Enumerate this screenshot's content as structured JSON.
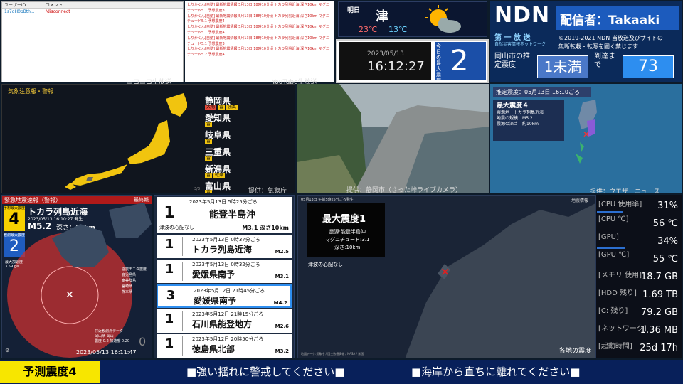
{
  "chat": {
    "col_user": "ユーザーID",
    "col_comment": "コメント",
    "user": "1s7dH0pBth...",
    "command": "/disconnect"
  },
  "youtube": {
    "lines": [
      "しりかくん[自動] 最新地震情報 5月13日 18時10分頃 トカラ列島近海 深さ10km マグニチュード5.1 予想震度3",
      "しりかくん[自動] 最新地震情報 5月13日 18時10分頃 トカラ列島近海 深さ10km マグニチュード5.1 予想震度4",
      "しりかくん[自動] 最新地震情報 5月13日 18時10分頃 トカラ列島近海 深さ10km マグニチュード5.1 予想震度4",
      "しりかくん[自動] 最新地震情報 5月13日 18時10分頃 トカラ列島近海 深さ10km マグニチュード5.1 予想震度3",
      "しりかくん[自動] 最新地震情報 5月13日 18時10分頃 トカラ列島近海 深さ10km マグニチュード5.2 予想震度4"
    ]
  },
  "weather": {
    "day": "明日",
    "city": "津",
    "high": "23℃",
    "low": "13℃"
  },
  "clock": {
    "date": "2023/05/13",
    "time": "16:12:27",
    "max_label": "今日の最大震度",
    "max_value": "2"
  },
  "ndn": {
    "logo": "NDN",
    "streamer": "配信者：Takaaki",
    "sub1": "第 一 放 送",
    "sub2": "自然災害情報ネットワーク",
    "copyright": "©2019-2021 NDN 当放送及びサイトの",
    "copyright2": "無断転載・転写を固く禁じます",
    "okayama": "岡山市の推定震度",
    "okayama_value": "1未満",
    "arrival": "到達まで",
    "arrival_value": "73"
  },
  "panel_labels": {
    "niconico": "ニコニコ生放送",
    "youtube": "YouTube生放送",
    "jma_credit": "提供：気象庁",
    "cam_credit": "提供：静岡市（さった峠ライブカメラ）",
    "weathernews_credit": "提供：ウエザーニュース"
  },
  "warnings": {
    "title": "気象注意報・警報",
    "prefs": [
      {
        "name": "静岡県",
        "tags": [
          "大雨",
          "雷",
          "強風"
        ]
      },
      {
        "name": "愛知県",
        "tags": [
          "雷"
        ]
      },
      {
        "name": "岐阜県",
        "tags": [
          "雷"
        ]
      },
      {
        "name": "三重県",
        "tags": [
          "雷"
        ]
      },
      {
        "name": "新潟県",
        "tags": [
          "雷",
          "乾燥"
        ]
      },
      {
        "name": "富山県",
        "tags": [
          "雷"
        ]
      }
    ],
    "page": "3/3"
  },
  "jma": {
    "title": "推定震度：05月13日 16:10ごろ",
    "max": "最大震度４",
    "epi_label": "震源地",
    "epi": "トカラ列島近海",
    "mag_label": "地震の規模",
    "mag": "M5.2",
    "depth_label": "震源の深さ",
    "depth": "約10km"
  },
  "eew": {
    "title": "緊急地震速報（警報）",
    "final": "最終報",
    "intensity": "4",
    "intensity_label": "予想最大震度",
    "region": "トカラ列島近海",
    "time": "2023/05/13 16:10:27 発生",
    "mag": "M5.2",
    "depth_label": "深さ：",
    "depth": "10km",
    "obs_label": "観測最大震度",
    "obs": "2",
    "legend": [
      "鹿児島県",
      "奄美群島",
      "宮崎県",
      "熊本県"
    ],
    "legend_title": "強震モニタ震度",
    "near_label": "付近観測点データ",
    "near_place": "岡山県 岡山",
    "near_vals": "震度-0.2 加速度 0.20",
    "near_value": "0",
    "timestamp": "2023/05/13 16:11:47",
    "accel_label": "最大加速度",
    "accel": "3.59 gal"
  },
  "quake_list": [
    {
      "shindo": "1",
      "date": "2023年5月13日 5時25分ごろ",
      "name": "能登半島沖",
      "sub": "津波の心配なし",
      "mag": "M3.1 深さ10km"
    },
    {
      "shindo": "1",
      "date": "2023年5月13日 0時37分ごろ",
      "name": "トカラ列島近海",
      "mag": "M2.5"
    },
    {
      "shindo": "1",
      "date": "2023年5月13日 0時32分ごろ",
      "name": "愛媛県南予",
      "mag": "M3.1"
    },
    {
      "shindo": "3",
      "date": "2023年5月12日 21時45分ごろ",
      "name": "愛媛県南予",
      "mag": "M4.2"
    },
    {
      "shindo": "1",
      "date": "2023年5月12日 21時15分ごろ",
      "name": "石川県能登地方",
      "mag": "M2.6"
    },
    {
      "shindo": "1",
      "date": "2023年5月12日 20時50分ごろ",
      "name": "徳島県北部",
      "mag": "M3.2"
    }
  ],
  "quake_map": {
    "head": "05月13日 午前5時25分ごろ発生",
    "top_right": "地震情報",
    "max": "最大震度1",
    "epi": "震源:能登半島沖",
    "mag": "マグニチュード:3.1",
    "depth": "深さ:10km",
    "tsunami": "津波の心配なし",
    "caption": "各地の震度",
    "src": "地図データ:気象庁 / 国土数値情報 / NASA / 米国"
  },
  "stats": [
    {
      "k": "[CPU 使用率]",
      "v": "31%"
    },
    {
      "k": "[CPU ℃]",
      "v": "56 ℃"
    },
    {
      "k": "[GPU]",
      "v": "34%"
    },
    {
      "k": "[GPU ℃]",
      "v": "55 ℃"
    },
    {
      "k": "[メモリ 使用]",
      "v": "18.7 GB"
    },
    {
      "k": "[HDD 残り]",
      "v": "1.69 TB"
    },
    {
      "k": "[C: 残り]",
      "v": "79.2 GB"
    },
    {
      "k": "[ネットワーク]",
      "v": "1.36 MB"
    },
    {
      "k": "[起動時間]",
      "v": "25d 17h"
    }
  ],
  "bottom": {
    "forecast": "予測震度4",
    "msg1": "■強い揺れに警戒してください■",
    "msg2": "■海岸から直ちに離れてください■"
  }
}
